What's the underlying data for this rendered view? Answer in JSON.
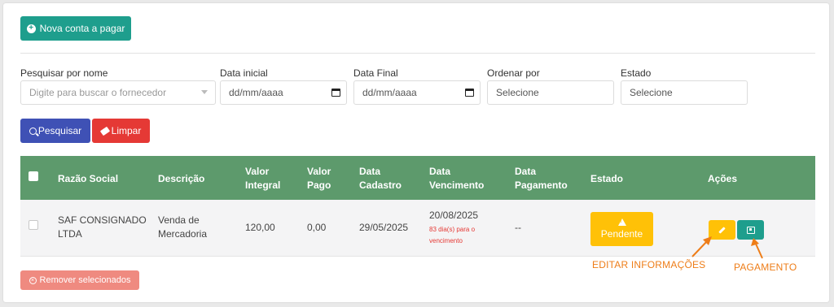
{
  "toolbar": {
    "new_label": "Nova conta a pagar"
  },
  "filters": {
    "name_label": "Pesquisar por nome",
    "name_placeholder": "Digite para buscar o fornecedor",
    "start_label": "Data inicial",
    "start_value": "dd/mm/aaaa",
    "end_label": "Data Final",
    "end_value": "dd/mm/aaaa",
    "order_label": "Ordenar por",
    "order_value": "Selecione",
    "state_label": "Estado",
    "state_value": "Selecione"
  },
  "actions": {
    "search_label": "Pesquisar",
    "clear_label": "Limpar"
  },
  "table": {
    "headers": {
      "razao": "Razão Social",
      "descricao": "Descrição",
      "valor_integral": [
        "Valor",
        "Integral"
      ],
      "valor_pago": [
        "Valor",
        "Pago"
      ],
      "data_cadastro": [
        "Data",
        "Cadastro"
      ],
      "data_vencimento": [
        "Data",
        "Vencimento"
      ],
      "data_pagamento": [
        "Data",
        "Pagamento"
      ],
      "estado": "Estado",
      "acoes": "Ações"
    },
    "rows": [
      {
        "razao": [
          "SAF CONSIGNADO",
          "LTDA"
        ],
        "descricao": [
          "Venda de",
          "Mercadoria"
        ],
        "valor_integral": "120,00",
        "valor_pago": "0,00",
        "data_cadastro": "29/05/2025",
        "data_vencimento": "20/08/2025",
        "vencimento_note": [
          "83 dia(s) para o",
          "vencimento"
        ],
        "data_pagamento": "--",
        "estado": "Pendente"
      }
    ]
  },
  "bulk": {
    "remove_label": "Remover selecionados"
  },
  "annotations": {
    "edit": "EDITAR INFORMAÇÕES",
    "payment": "PAGAMENTO"
  },
  "colors": {
    "teal": "#1e9e8d",
    "header_green": "#5d9a6c",
    "search_blue": "#3f51b5",
    "clear_red": "#e53935",
    "pending_yellow": "#ffc107",
    "remove_salmon": "#ef8a80",
    "annotation_orange": "#ee7d18"
  },
  "icons": {
    "new": "plus-circle-icon",
    "search": "search-icon",
    "clear": "eraser-icon",
    "pending": "warning-icon",
    "edit": "pencil-icon",
    "pay": "payment-icon",
    "remove": "x-circle-icon",
    "date": "calendar-icon",
    "select": "chevron-down-icon"
  }
}
